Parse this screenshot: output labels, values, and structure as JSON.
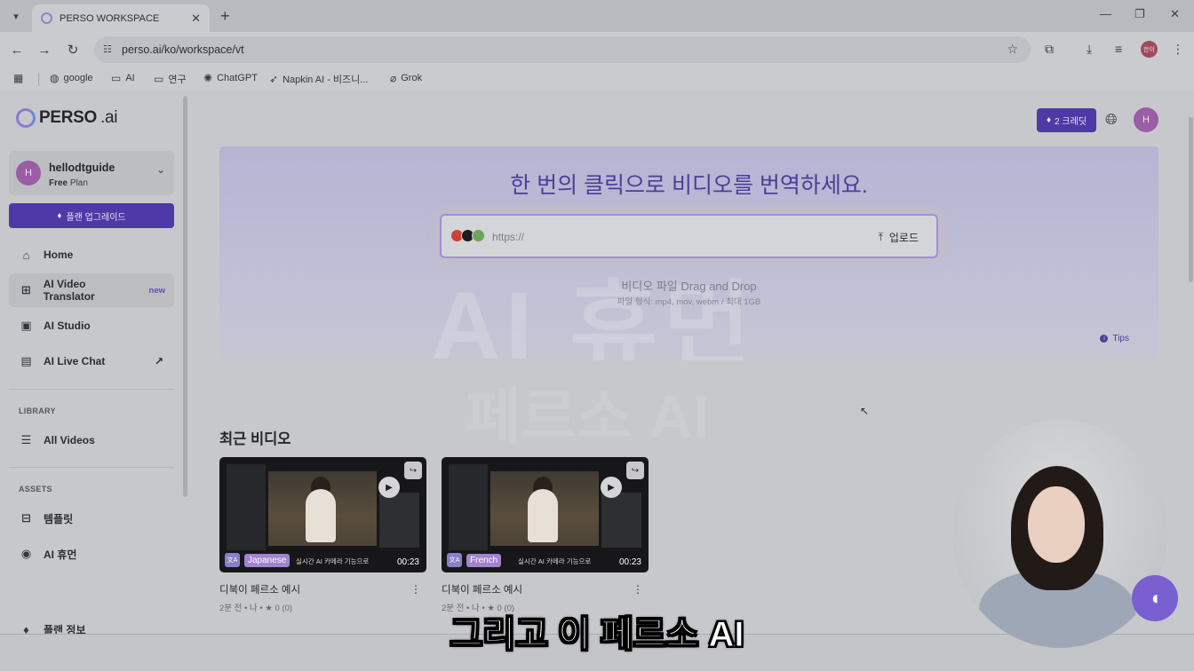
{
  "browser": {
    "tab_title": "PERSO WORKSPACE",
    "url": "perso.ai/ko/workspace/vt",
    "profile_label": "한이",
    "bookmarks": [
      {
        "label": "google",
        "icon": "globe-icon"
      },
      {
        "label": "AI",
        "icon": "folder-icon"
      },
      {
        "label": "연구",
        "icon": "folder-icon"
      },
      {
        "label": "ChatGPT",
        "icon": "chatgpt-icon"
      },
      {
        "label": "Napkin AI - 비즈니...",
        "icon": "napkin-icon"
      },
      {
        "label": "Grok",
        "icon": "grok-icon"
      }
    ]
  },
  "sidebar": {
    "logo_text": "PERSO",
    "logo_suffix": ".ai",
    "user": {
      "initial": "H",
      "name": "hellodtguide",
      "plan_free": "Free",
      "plan_word": "Plan"
    },
    "upgrade_label": "플랜 업그레이드",
    "nav": [
      {
        "label": "Home",
        "icon": "home-icon"
      },
      {
        "label": "AI Video Translator",
        "icon": "translate-icon",
        "badge": "new",
        "active": true
      },
      {
        "label": "AI Studio",
        "icon": "studio-icon"
      },
      {
        "label": "AI Live Chat",
        "icon": "chat-icon",
        "external": "↗"
      }
    ],
    "library_label": "LIBRARY",
    "library": [
      {
        "label": "All Videos",
        "icon": "videos-icon"
      }
    ],
    "assets_label": "ASSETS",
    "assets": [
      {
        "label": "템플릿",
        "icon": "template-icon"
      },
      {
        "label": "AI 휴먼",
        "icon": "ai-human-icon"
      }
    ],
    "plan_info_label": "플랜 정보"
  },
  "header": {
    "credits_label": "2 크레딧",
    "avatar_initial": "H"
  },
  "hero": {
    "title": "한 번의 클릭으로 비디오를 번역하세요.",
    "url_placeholder": "https://",
    "upload_label": "업로드",
    "dnd_text": "비디오 파일 Drag and Drop",
    "formats_text": "파일 형식: mp4, mov, webm / 최대 1GB",
    "tips_label": "Tips",
    "bg_text": "AI 휴먼",
    "ghost_text": "페르소 AI"
  },
  "recent": {
    "title": "최근 비디오",
    "videos": [
      {
        "title": "디북이 페르소 예시",
        "language": "Japanese",
        "caption": "실시간 AI 카메라 기능으로",
        "duration": "00:23",
        "meta": "2분 전 • 나 • ★ 0 (0)"
      },
      {
        "title": "디북이 페르소 예시",
        "language": "French",
        "caption": "실시간 AI 카메라 기능으로",
        "duration": "00:23",
        "meta": "2분 전 • 나 • ★ 0 (0)"
      }
    ]
  },
  "overlay": {
    "subtitle": "그리고 이 페르소 AI"
  },
  "colors": {
    "brand_purple": "#4e39a6",
    "title_purple": "#4b3e98",
    "badge_purple": "#6b4bb8"
  }
}
